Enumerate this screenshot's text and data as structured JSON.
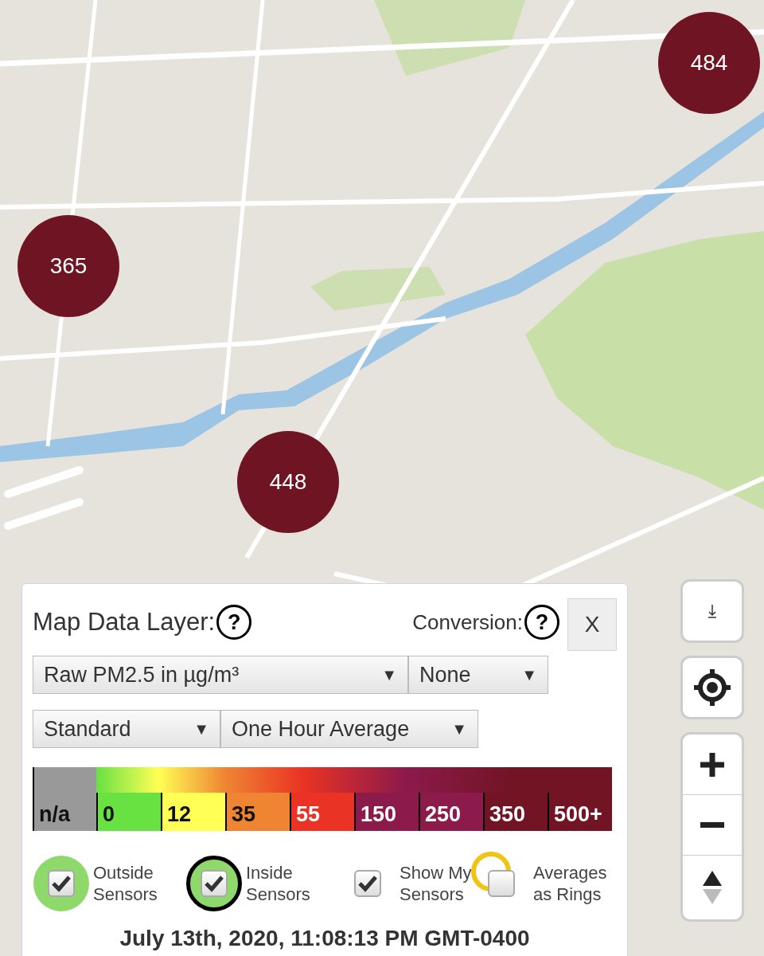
{
  "map": {
    "kind": "picture",
    "markers": [
      {
        "label": "484",
        "color": "#6e1423"
      },
      {
        "label": "365",
        "color": "#6e1423"
      },
      {
        "label": "448",
        "color": "#6e1423"
      }
    ]
  },
  "panel": {
    "title": "Map Data Layer:",
    "title_help": "?",
    "conversion_label": "Conversion:",
    "conversion_help": "?",
    "close": "X",
    "dropdowns": [
      {
        "value": "Raw PM2.5 in µg/m³",
        "arrow": "▼"
      },
      {
        "value": "None",
        "arrow": "▼"
      },
      {
        "value": "Standard",
        "arrow": "▼"
      },
      {
        "value": "One Hour Average",
        "arrow": "▼"
      }
    ],
    "legend": [
      {
        "label": "n/a",
        "color": "#999999"
      },
      {
        "label": "0",
        "color": "#68e143"
      },
      {
        "label": "12",
        "color": "#ffff55"
      },
      {
        "label": "35",
        "color": "#ef8533"
      },
      {
        "label": "55",
        "color": "#ea3324"
      },
      {
        "label": "150",
        "color": "#8c1a4b"
      },
      {
        "label": "250",
        "color": "#8c1a4b"
      },
      {
        "label": "350",
        "color": "#731425"
      },
      {
        "label": "500+",
        "color": "#731425"
      }
    ],
    "toggles": [
      {
        "label": "Outside Sensors",
        "checked": true,
        "kind": "dot",
        "color": "#8fd86b"
      },
      {
        "label": "Inside Sensors",
        "checked": true,
        "kind": "ringed-dot",
        "color": "#8fd86b"
      },
      {
        "label": "Show My Sensors",
        "checked": true,
        "kind": "plain"
      },
      {
        "label": "Averages as Rings",
        "checked": false,
        "kind": "ring",
        "color": "#f2c311"
      }
    ],
    "timestamp": "July 13th, 2020, 11:08:13 PM GMT-0400"
  }
}
